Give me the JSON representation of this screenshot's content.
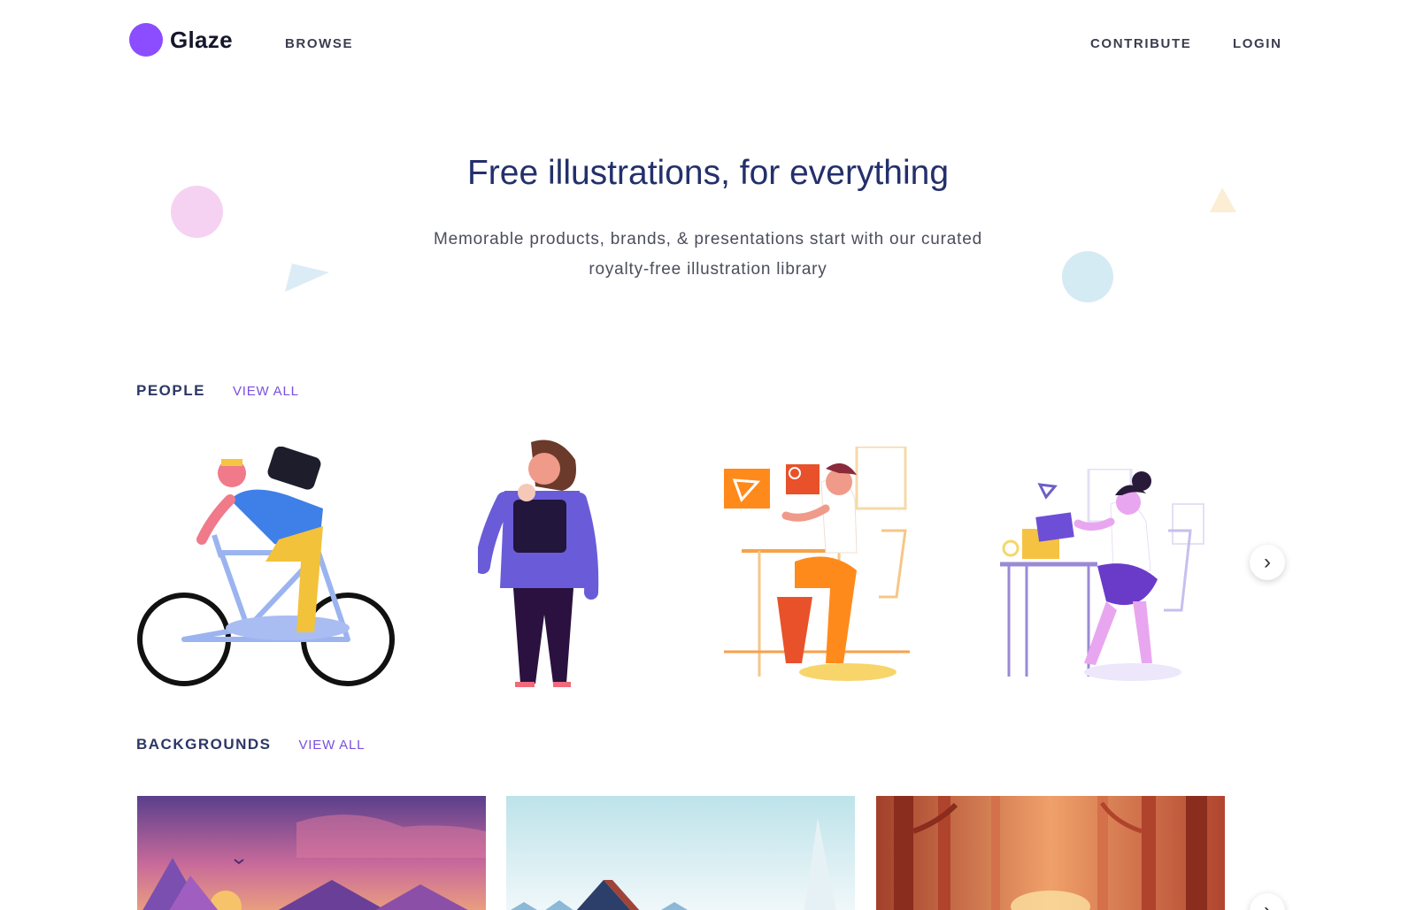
{
  "header": {
    "logo_text": "Glaze",
    "nav": {
      "browse": "BROWSE",
      "contribute": "CONTRIBUTE",
      "login": "LOGIN"
    }
  },
  "hero": {
    "title": "Free illustrations, for everything",
    "subtitle": "Memorable products, brands, & presentations start with our curated royalty-free illustration library"
  },
  "sections": {
    "people": {
      "title": "PEOPLE",
      "view_all": "VIEW ALL"
    },
    "backgrounds": {
      "title": "BACKGROUNDS",
      "view_all": "VIEW ALL"
    }
  },
  "colors": {
    "brand": "#8b4dff",
    "title": "#23306b",
    "link": "#7a4fe0"
  },
  "icons": {
    "next": "chevron-right-icon"
  }
}
